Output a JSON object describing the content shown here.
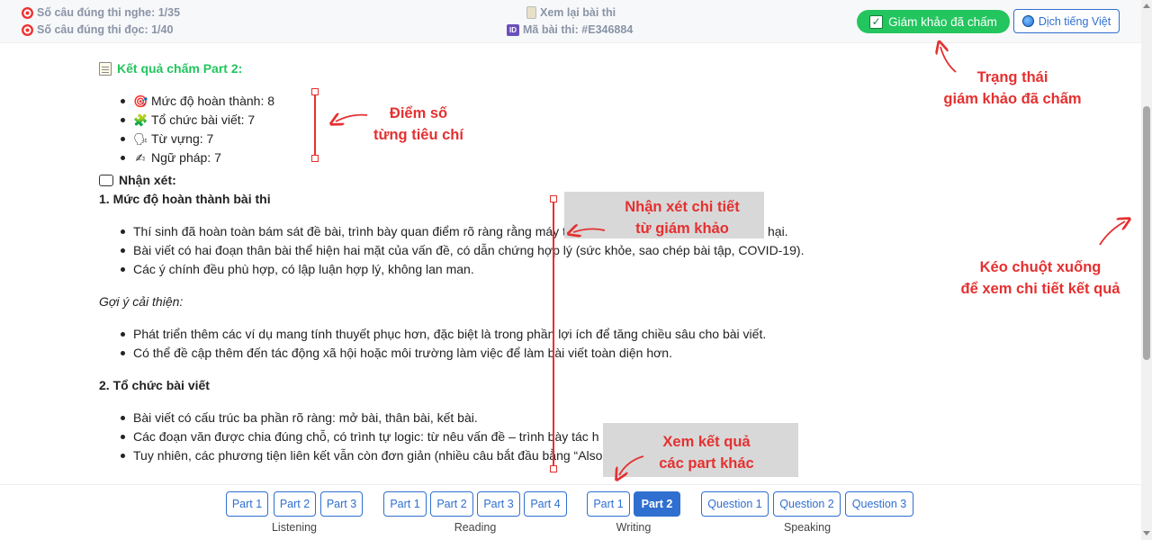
{
  "header": {
    "listening_correct": "Số câu đúng thi nghe: 1/35",
    "reading_correct": "Số câu đúng thi đọc: 1/40",
    "review_link": "Xem lại bài thi",
    "exam_code": "Mã bài thi: #E346884",
    "id_badge": "ID",
    "graded_button": "Giám khảo đã chấm",
    "translate_button": "Dịch tiếng Việt"
  },
  "content": {
    "section_title": "Kết quả chấm Part 2:",
    "criteria": [
      {
        "icon": "🎯",
        "label": "Mức độ hoàn thành: 8"
      },
      {
        "icon": "🧩",
        "label": "Tổ chức bài viết: 7"
      },
      {
        "icon": "🗣",
        "label": "Từ vựng: 7"
      },
      {
        "icon": "✍",
        "label": "Ngữ pháp: 7"
      }
    ],
    "comment_heading": "Nhận xét:",
    "sec1_title": "1. Mức độ hoàn thành bài thi",
    "sec1_items": [
      "Thí sinh đã hoàn toàn bám sát đề bài, trình bày quan điểm rõ ràng rằng máy t",
      "Bài viết có hai đoạn thân bài thể hiện hai mặt của vấn đề, có dẫn chứng hợp lý (sức khỏe, sao chép bài tập, COVID-19).",
      "Các ý chính đều phù hợp, có lập luận hợp lý, không lan man."
    ],
    "sec1_tail": "hại.",
    "suggest_label": "Gợi ý cải thiện:",
    "suggest_items": [
      "Phát triển thêm các ví dụ mang tính thuyết phục hơn, đặc biệt là trong phần lợi ích để tăng chiều sâu cho bài viết.",
      "Có thể đề cập thêm đến tác động xã hội hoặc môi trường làm việc để làm bài viết toàn diện hơn."
    ],
    "sec2_title": "2. Tổ chức bài viết",
    "sec2_items": [
      "Bài viết có cấu trúc ba phần rõ ràng: mở bài, thân bài, kết bài.",
      "Các đoạn văn được chia đúng chỗ, có trình tự logic: từ nêu vấn đề – trình bày tác h",
      "Tuy nhiên, các phương tiện liên kết vẫn còn đơn giản (nhiều câu bắt đầu bằng “Also"
    ]
  },
  "nav": {
    "listening": {
      "label": "Listening",
      "parts": [
        "Part 1",
        "Part 2",
        "Part 3"
      ]
    },
    "reading": {
      "label": "Reading",
      "parts": [
        "Part 1",
        "Part 2",
        "Part 3",
        "Part 4"
      ]
    },
    "writing": {
      "label": "Writing",
      "parts": [
        "Part 1",
        "Part 2"
      ],
      "active": "Part 2"
    },
    "speaking": {
      "label": "Speaking",
      "parts": [
        "Question 1",
        "Question 2",
        "Question 3"
      ]
    }
  },
  "annotations": {
    "status_line1": "Trạng thái",
    "status_line2": "giám khảo đã chấm",
    "score_line1": "Điểm số",
    "score_line2": "từng tiêu chí",
    "comment_line1": "Nhận xét chi tiết",
    "comment_line2": "từ giám khảo",
    "scroll_line1": "Kéo chuột xuống",
    "scroll_line2": "để xem chi tiết kết quả",
    "parts_line1": "Xem kết quả",
    "parts_line2": "các part khác"
  },
  "colors": {
    "green": "#22c55e",
    "blue": "#2f6fd0",
    "red": "#e53030"
  }
}
